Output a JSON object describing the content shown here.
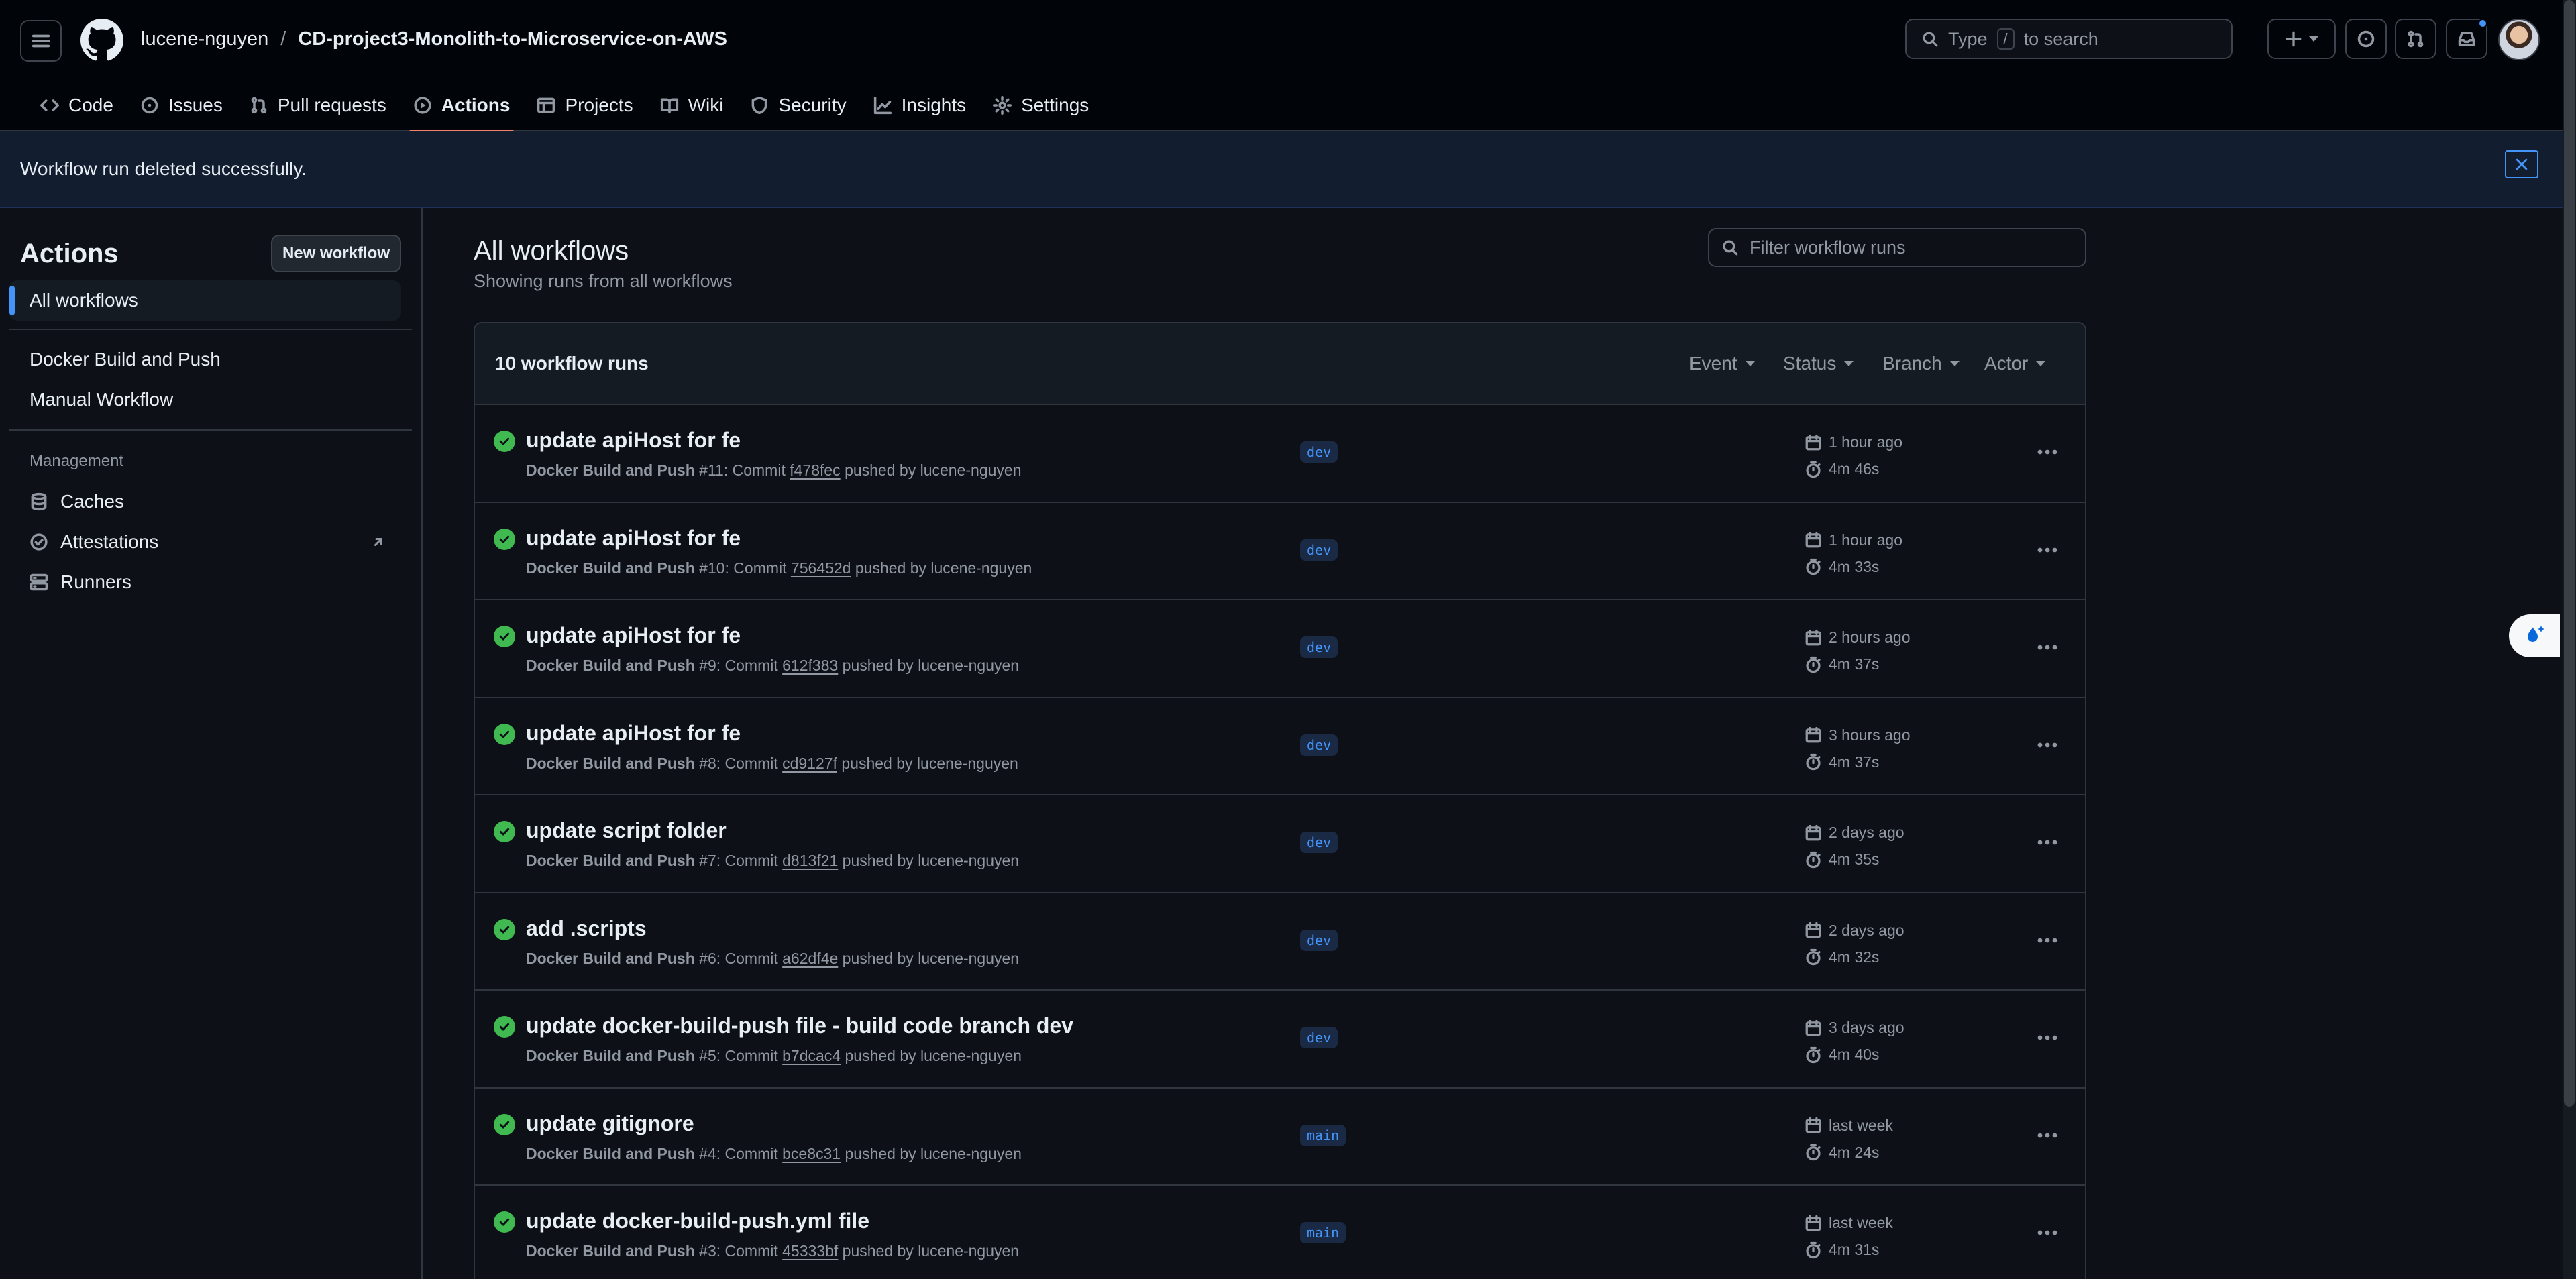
{
  "header": {
    "owner": "lucene-nguyen",
    "separator": "/",
    "repo": "CD-project3-Monolith-to-Microservice-on-AWS",
    "search_prefix": "Type",
    "search_key": "/",
    "search_suffix": "to search"
  },
  "tabs": [
    {
      "label": "Code",
      "icon": "code-icon"
    },
    {
      "label": "Issues",
      "icon": "issue-icon"
    },
    {
      "label": "Pull requests",
      "icon": "pull-request-icon"
    },
    {
      "label": "Actions",
      "icon": "play-icon",
      "active": true
    },
    {
      "label": "Projects",
      "icon": "table-icon"
    },
    {
      "label": "Wiki",
      "icon": "book-icon"
    },
    {
      "label": "Security",
      "icon": "shield-icon"
    },
    {
      "label": "Insights",
      "icon": "graph-icon"
    },
    {
      "label": "Settings",
      "icon": "gear-icon"
    }
  ],
  "flash": {
    "message": "Workflow run deleted successfully."
  },
  "sidebar": {
    "title": "Actions",
    "new_workflow": "New workflow",
    "all_workflows": "All workflows",
    "workflows": [
      "Docker Build and Push",
      "Manual Workflow"
    ],
    "management_label": "Management",
    "management": [
      {
        "label": "Caches",
        "icon": "database-icon"
      },
      {
        "label": "Attestations",
        "icon": "verified-icon"
      },
      {
        "label": "Runners",
        "icon": "server-icon"
      }
    ]
  },
  "main": {
    "title": "All workflows",
    "subtitle": "Showing runs from all workflows",
    "filter_placeholder": "Filter workflow runs",
    "runs_count": "10 workflow runs",
    "filters": [
      "Event",
      "Status",
      "Branch",
      "Actor"
    ]
  },
  "runs": [
    {
      "title": "update apiHost for fe",
      "workflow": "Docker Build and Push",
      "number": "#11",
      "commit": "f478fec",
      "actor": "lucene-nguyen",
      "branch": "dev",
      "time": "1 hour ago",
      "duration": "4m 46s"
    },
    {
      "title": "update apiHost for fe",
      "workflow": "Docker Build and Push",
      "number": "#10",
      "commit": "756452d",
      "actor": "lucene-nguyen",
      "branch": "dev",
      "time": "1 hour ago",
      "duration": "4m 33s"
    },
    {
      "title": "update apiHost for fe",
      "workflow": "Docker Build and Push",
      "number": "#9",
      "commit": "612f383",
      "actor": "lucene-nguyen",
      "branch": "dev",
      "time": "2 hours ago",
      "duration": "4m 37s"
    },
    {
      "title": "update apiHost for fe",
      "workflow": "Docker Build and Push",
      "number": "#8",
      "commit": "cd9127f",
      "actor": "lucene-nguyen",
      "branch": "dev",
      "time": "3 hours ago",
      "duration": "4m 37s"
    },
    {
      "title": "update script folder",
      "workflow": "Docker Build and Push",
      "number": "#7",
      "commit": "d813f21",
      "actor": "lucene-nguyen",
      "branch": "dev",
      "time": "2 days ago",
      "duration": "4m 35s"
    },
    {
      "title": "add .scripts",
      "workflow": "Docker Build and Push",
      "number": "#6",
      "commit": "a62df4e",
      "actor": "lucene-nguyen",
      "branch": "dev",
      "time": "2 days ago",
      "duration": "4m 32s"
    },
    {
      "title": "update docker-build-push file - build code branch dev",
      "workflow": "Docker Build and Push",
      "number": "#5",
      "commit": "b7dcac4",
      "actor": "lucene-nguyen",
      "branch": "dev",
      "time": "3 days ago",
      "duration": "4m 40s"
    },
    {
      "title": "update gitignore",
      "workflow": "Docker Build and Push",
      "number": "#4",
      "commit": "bce8c31",
      "actor": "lucene-nguyen",
      "branch": "main",
      "time": "last week",
      "duration": "4m 24s"
    },
    {
      "title": "update docker-build-push.yml file",
      "workflow": "Docker Build and Push",
      "number": "#3",
      "commit": "45333bf",
      "actor": "lucene-nguyen",
      "branch": "main",
      "time": "last week",
      "duration": "4m 31s"
    }
  ],
  "colors": {
    "background": "#0d1117",
    "header": "#010409",
    "accent": "#4493f8",
    "active_tab": "#f78166",
    "success": "#3fb950",
    "muted": "#9198a1",
    "border": "#30363d"
  }
}
